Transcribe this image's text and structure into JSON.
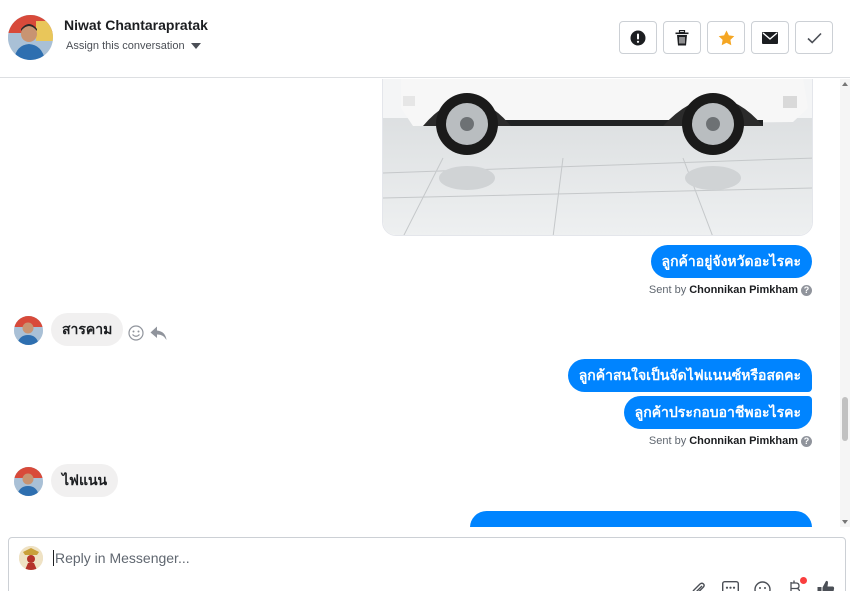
{
  "header": {
    "contact_name": "Niwat Chantarapratak",
    "assign_label": "Assign this conversation"
  },
  "toolbar": {
    "actions": [
      "spam-icon",
      "trash-icon",
      "star-icon",
      "envelope-icon",
      "check-icon"
    ],
    "star_color": "#f5a623"
  },
  "thread": {
    "messages": [
      {
        "side": "out",
        "text": "ลูกค้าอยู่จังหวัดอะไรคะ"
      },
      {
        "side": "in",
        "text": "สารคาม"
      },
      {
        "side": "out",
        "text": "ลูกค้าสนใจเป็นจัดไฟแนนซ์หรือสดคะ"
      },
      {
        "side": "out",
        "text": "ลูกค้าประกอบอาชีพอะไรคะ"
      },
      {
        "side": "in",
        "text": "ไฟแนน"
      }
    ],
    "sent_by_prefix": "Sent by",
    "sent_by_name": "Chonnikan Pimkham",
    "sent_by_help": "?",
    "accent_color": "#0084ff"
  },
  "composer": {
    "placeholder": "Reply in Messenger...",
    "tools": [
      "attach-icon",
      "saved-replies-icon",
      "emoji-icon",
      "payment-icon",
      "like-icon"
    ]
  }
}
